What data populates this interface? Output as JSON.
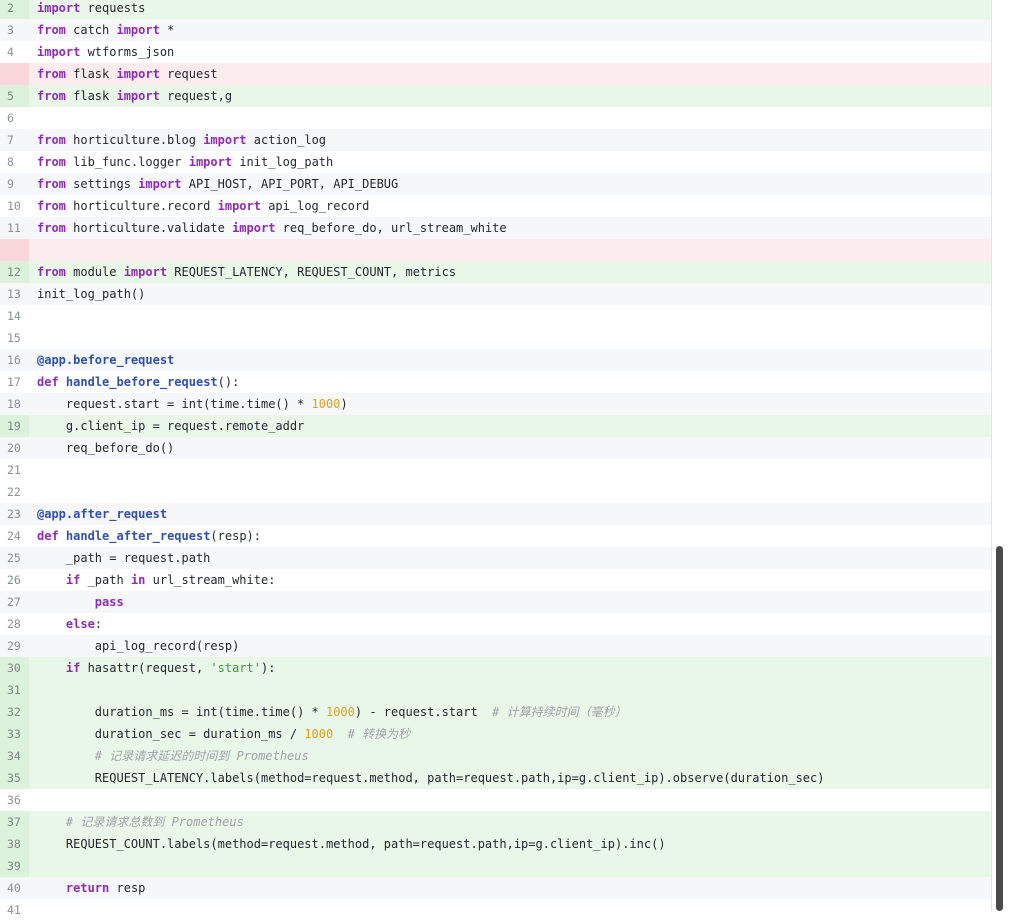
{
  "editor": {
    "lines": [
      {
        "num": "2",
        "type": "added",
        "tokens": [
          {
            "t": "import",
            "c": "kw"
          },
          {
            "t": " requests",
            "c": "plain"
          }
        ]
      },
      {
        "num": "3",
        "type": "context-alt",
        "tokens": [
          {
            "t": "from",
            "c": "kw"
          },
          {
            "t": " catch ",
            "c": "plain"
          },
          {
            "t": "import",
            "c": "kw"
          },
          {
            "t": " *",
            "c": "plain"
          }
        ]
      },
      {
        "num": "4",
        "type": "context-plain",
        "tokens": [
          {
            "t": "import",
            "c": "kw"
          },
          {
            "t": " wtforms_json",
            "c": "plain"
          }
        ]
      },
      {
        "num": "",
        "type": "removed",
        "tokens": [
          {
            "t": "from",
            "c": "kw"
          },
          {
            "t": " flask ",
            "c": "plain"
          },
          {
            "t": "import",
            "c": "kw"
          },
          {
            "t": " request",
            "c": "plain"
          }
        ]
      },
      {
        "num": "5",
        "type": "added",
        "tokens": [
          {
            "t": "from",
            "c": "kw"
          },
          {
            "t": " flask ",
            "c": "plain"
          },
          {
            "t": "import",
            "c": "kw"
          },
          {
            "t": " request,g",
            "c": "plain"
          }
        ]
      },
      {
        "num": "6",
        "type": "context-plain",
        "tokens": []
      },
      {
        "num": "7",
        "type": "context-alt",
        "tokens": [
          {
            "t": "from",
            "c": "kw"
          },
          {
            "t": " horticulture.blog ",
            "c": "plain"
          },
          {
            "t": "import",
            "c": "kw"
          },
          {
            "t": " action_log",
            "c": "plain"
          }
        ]
      },
      {
        "num": "8",
        "type": "context-plain",
        "tokens": [
          {
            "t": "from",
            "c": "kw"
          },
          {
            "t": " lib_func.logger ",
            "c": "plain"
          },
          {
            "t": "import",
            "c": "kw"
          },
          {
            "t": " init_log_path",
            "c": "plain"
          }
        ]
      },
      {
        "num": "9",
        "type": "context-alt",
        "tokens": [
          {
            "t": "from",
            "c": "kw"
          },
          {
            "t": " settings ",
            "c": "plain"
          },
          {
            "t": "import",
            "c": "kw"
          },
          {
            "t": " API_HOST, API_PORT, API_DEBUG",
            "c": "plain"
          }
        ]
      },
      {
        "num": "10",
        "type": "context-plain",
        "tokens": [
          {
            "t": "from",
            "c": "kw"
          },
          {
            "t": " horticulture.record ",
            "c": "plain"
          },
          {
            "t": "import",
            "c": "kw"
          },
          {
            "t": " api_log_record",
            "c": "plain"
          }
        ]
      },
      {
        "num": "11",
        "type": "context-alt",
        "tokens": [
          {
            "t": "from",
            "c": "kw"
          },
          {
            "t": " horticulture.validate ",
            "c": "plain"
          },
          {
            "t": "import",
            "c": "kw"
          },
          {
            "t": " req_before_do, url_stream_white",
            "c": "plain"
          }
        ]
      },
      {
        "num": "",
        "type": "removed",
        "tokens": []
      },
      {
        "num": "12",
        "type": "added",
        "tokens": [
          {
            "t": "from",
            "c": "kw"
          },
          {
            "t": " module ",
            "c": "plain"
          },
          {
            "t": "import",
            "c": "kw"
          },
          {
            "t": " REQUEST_LATENCY, REQUEST_COUNT, metrics",
            "c": "plain"
          }
        ]
      },
      {
        "num": "13",
        "type": "context-alt",
        "tokens": [
          {
            "t": "init_log_path()",
            "c": "plain"
          }
        ]
      },
      {
        "num": "14",
        "type": "context-plain",
        "tokens": []
      },
      {
        "num": "15",
        "type": "context-plain",
        "tokens": []
      },
      {
        "num": "16",
        "type": "context-alt",
        "tokens": [
          {
            "t": "@app.before_request",
            "c": "dec"
          }
        ]
      },
      {
        "num": "17",
        "type": "context-plain",
        "tokens": [
          {
            "t": "def",
            "c": "def"
          },
          {
            "t": " ",
            "c": "plain"
          },
          {
            "t": "handle_before_request",
            "c": "fn"
          },
          {
            "t": "():",
            "c": "plain"
          }
        ]
      },
      {
        "num": "18",
        "type": "context-alt",
        "tokens": [
          {
            "t": "    request.start = int(time.time() * ",
            "c": "plain"
          },
          {
            "t": "1000",
            "c": "num"
          },
          {
            "t": ")",
            "c": "plain"
          }
        ]
      },
      {
        "num": "19",
        "type": "added",
        "tokens": [
          {
            "t": "    g.client_ip = request.remote_addr",
            "c": "plain"
          }
        ]
      },
      {
        "num": "20",
        "type": "context-alt",
        "tokens": [
          {
            "t": "    req_before_do()",
            "c": "plain"
          }
        ]
      },
      {
        "num": "21",
        "type": "context-plain",
        "tokens": []
      },
      {
        "num": "22",
        "type": "context-plain",
        "tokens": []
      },
      {
        "num": "23",
        "type": "context-alt",
        "tokens": [
          {
            "t": "@app.after_request",
            "c": "dec"
          }
        ]
      },
      {
        "num": "24",
        "type": "context-plain",
        "tokens": [
          {
            "t": "def",
            "c": "def"
          },
          {
            "t": " ",
            "c": "plain"
          },
          {
            "t": "handle_after_request",
            "c": "fn"
          },
          {
            "t": "(resp):",
            "c": "plain"
          }
        ]
      },
      {
        "num": "25",
        "type": "context-alt",
        "tokens": [
          {
            "t": "    _path = request.path",
            "c": "plain"
          }
        ]
      },
      {
        "num": "26",
        "type": "context-plain",
        "tokens": [
          {
            "t": "    ",
            "c": "plain"
          },
          {
            "t": "if",
            "c": "kw"
          },
          {
            "t": " _path ",
            "c": "plain"
          },
          {
            "t": "in",
            "c": "kw"
          },
          {
            "t": " url_stream_white:",
            "c": "plain"
          }
        ]
      },
      {
        "num": "27",
        "type": "context-alt",
        "tokens": [
          {
            "t": "        ",
            "c": "plain"
          },
          {
            "t": "pass",
            "c": "kw"
          }
        ]
      },
      {
        "num": "28",
        "type": "context-plain",
        "tokens": [
          {
            "t": "    ",
            "c": "plain"
          },
          {
            "t": "else",
            "c": "kw"
          },
          {
            "t": ":",
            "c": "plain"
          }
        ]
      },
      {
        "num": "29",
        "type": "context-alt",
        "tokens": [
          {
            "t": "        api_log_record(resp)",
            "c": "plain"
          }
        ]
      },
      {
        "num": "30",
        "type": "added",
        "tokens": [
          {
            "t": "    ",
            "c": "plain"
          },
          {
            "t": "if",
            "c": "kw"
          },
          {
            "t": " hasattr(request, ",
            "c": "plain"
          },
          {
            "t": "'start'",
            "c": "str"
          },
          {
            "t": "):",
            "c": "plain"
          }
        ]
      },
      {
        "num": "31",
        "type": "added",
        "tokens": []
      },
      {
        "num": "32",
        "type": "added",
        "tokens": [
          {
            "t": "        duration_ms = int(time.time() * ",
            "c": "plain"
          },
          {
            "t": "1000",
            "c": "num"
          },
          {
            "t": ") - request.start  ",
            "c": "plain"
          },
          {
            "t": "# 计算持续时间（毫秒）",
            "c": "cm"
          }
        ]
      },
      {
        "num": "33",
        "type": "added",
        "tokens": [
          {
            "t": "        duration_sec = duration_ms / ",
            "c": "plain"
          },
          {
            "t": "1000",
            "c": "num"
          },
          {
            "t": "  ",
            "c": "plain"
          },
          {
            "t": "# 转换为秒",
            "c": "cm"
          }
        ]
      },
      {
        "num": "34",
        "type": "added",
        "tokens": [
          {
            "t": "        ",
            "c": "plain"
          },
          {
            "t": "# 记录请求延迟的时间到 Prometheus",
            "c": "cm"
          }
        ]
      },
      {
        "num": "35",
        "type": "added",
        "tokens": [
          {
            "t": "        REQUEST_LATENCY.labels(method=request.method, path=request.path,ip=g.client_ip).observe(duration_sec)",
            "c": "plain"
          }
        ]
      },
      {
        "num": "36",
        "type": "context-plain",
        "tokens": []
      },
      {
        "num": "37",
        "type": "added",
        "tokens": [
          {
            "t": "    ",
            "c": "plain"
          },
          {
            "t": "# 记录请求总数到 Prometheus",
            "c": "cm"
          }
        ]
      },
      {
        "num": "38",
        "type": "added",
        "tokens": [
          {
            "t": "    REQUEST_COUNT.labels(method=request.method, path=request.path,ip=g.client_ip).inc()",
            "c": "plain"
          }
        ]
      },
      {
        "num": "39",
        "type": "added",
        "tokens": []
      },
      {
        "num": "40",
        "type": "context-alt",
        "tokens": [
          {
            "t": "    ",
            "c": "plain"
          },
          {
            "t": "return",
            "c": "kw"
          },
          {
            "t": " resp",
            "c": "plain"
          }
        ]
      },
      {
        "num": "41",
        "type": "context-plain",
        "tokens": []
      }
    ]
  },
  "colors": {
    "added_bg": "#e9f7e9",
    "removed_bg": "#fdecee",
    "keyword": "#8f2bb8",
    "function": "#2f4fb5",
    "number": "#d9a21c",
    "string": "#3a9b3a",
    "comment": "#a0a4a8"
  },
  "scrollbar": {
    "position": 0.6
  }
}
